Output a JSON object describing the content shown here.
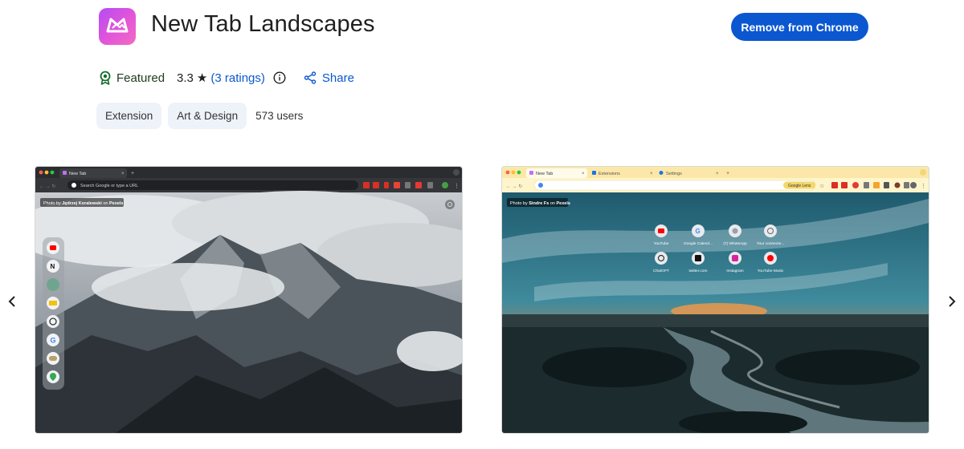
{
  "listing": {
    "title": "New Tab Landscapes",
    "action_button": "Remove from Chrome",
    "featured_label": "Featured",
    "rating_value": "3.3",
    "rating_star": "★",
    "ratings_link": "(3 ratings)",
    "share_label": "Share",
    "chips": [
      "Extension",
      "Art & Design"
    ],
    "users": "573 users"
  },
  "screenshot1": {
    "tab_title": "New Tab",
    "new_tab_glyph": "+",
    "address_placeholder": "Search Google or type a URL",
    "credit_prefix": "Photo by",
    "credit_author": "Jędrzej Koralewski",
    "credit_on": "on",
    "credit_site": "Pexels"
  },
  "screenshot2": {
    "tabs": [
      "New Tab",
      "Extensions",
      "Settings"
    ],
    "lens_label": "Google Lens",
    "credit_prefix": "Photo by",
    "credit_author": "Sindre Fs",
    "credit_on": "on",
    "credit_site": "Pexels",
    "shortcuts": [
      "YouTube",
      "Google Calend...",
      "(7) WhatsApp",
      "Your connecte...",
      "ChatGPT",
      "twitter.com",
      "Instagram",
      "YouTube Music"
    ]
  },
  "colors": {
    "primary": "#0b57d0",
    "featured_green": "#146c2e",
    "chip_bg": "#eef2f9"
  },
  "icons": {
    "featured": "award-badge-icon",
    "info": "info-circle-icon",
    "share": "share-icon",
    "prev": "chevron-left-icon",
    "next": "chevron-right-icon"
  }
}
